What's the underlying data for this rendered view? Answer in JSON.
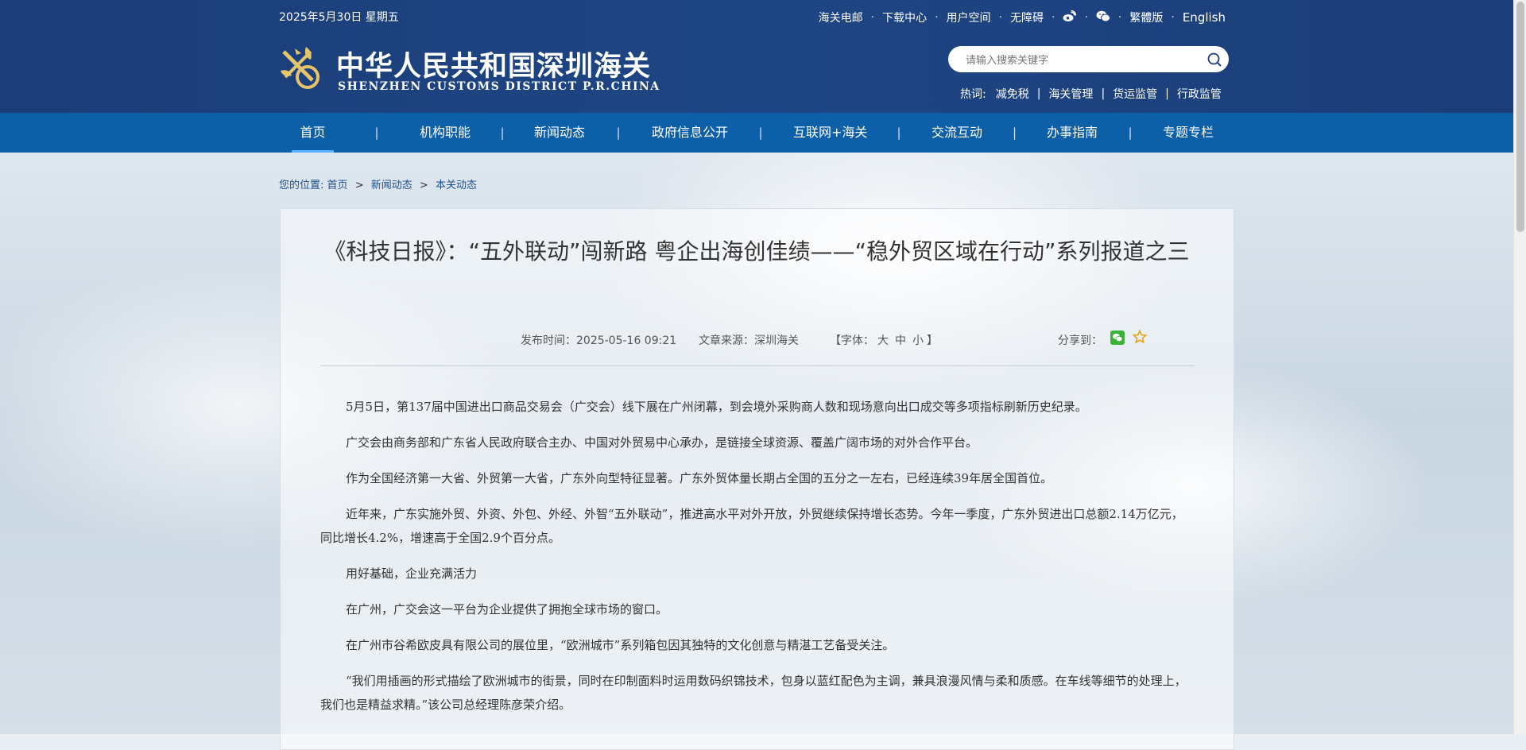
{
  "header": {
    "date": "2025年5月30日 星期五",
    "toplinks": [
      "海关电邮",
      "下载中心",
      "用户空间",
      "无障碍"
    ],
    "traditional": "繁體版",
    "english": "English",
    "logo_cn": "中华人民共和国深圳海关",
    "logo_en": "SHENZHEN CUSTOMS DISTRICT P.R.CHINA",
    "search_placeholder": "请输入搜索关键字",
    "hot_label": "热词:",
    "hot_words": [
      "减免税",
      "海关管理",
      "货运监管",
      "行政监管"
    ]
  },
  "nav": {
    "items": [
      "首页",
      "机构职能",
      "新闻动态",
      "政府信息公开",
      "互联网+海关",
      "交流互动",
      "办事指南",
      "专题专栏"
    ],
    "sep": "|"
  },
  "breadcrumb": {
    "label": "您的位置:",
    "items": [
      "首页",
      "新闻动态",
      "本关动态"
    ],
    "gt": ">"
  },
  "article": {
    "title": "《科技日报》：“五外联动”闯新路 粤企出海创佳绩——“稳外贸区域在行动”系列报道之三",
    "publish": "发布时间：2025-05-16 09:21",
    "source": "文章来源：深圳海关",
    "font_open": "【字体：",
    "font_sizes": [
      "大",
      "中",
      "小"
    ],
    "font_close": "】",
    "share": "分享到：",
    "paragraphs": [
      "5月5日，第137届中国进出口商品交易会（广交会）线下展在广州闭幕，到会境外采购商人数和现场意向出口成交等多项指标刷新历史纪录。",
      "广交会由商务部和广东省人民政府联合主办、中国对外贸易中心承办，是链接全球资源、覆盖广阔市场的对外合作平台。",
      "作为全国经济第一大省、外贸第一大省，广东外向型特征显著。广东外贸体量长期占全国的五分之一左右，已经连续39年居全国首位。",
      "近年来，广东实施外贸、外资、外包、外经、外智“五外联动”，推进高水平对外开放，外贸继续保持增长态势。今年一季度，广东外贸进出口总额2.14万亿元，同比增长4.2%，增速高于全国2.9个百分点。",
      "用好基础，企业充满活力",
      "在广州，广交会这一平台为企业提供了拥抱全球市场的窗口。",
      "在广州市谷希欧皮具有限公司的展位里，“欧洲城市”系列箱包因其独特的文化创意与精湛工艺备受关注。",
      "“我们用插画的形式描绘了欧洲城市的街景，同时在印制面料时运用数码织锦技术，包身以蓝红配色为主调，兼具浪漫风情与柔和质感。在车线等细节的处理上，我们也是精益求精。”该公司总经理陈彦荣介绍。"
    ]
  },
  "colors": {
    "header_bg": "#1e4684",
    "nav_bg": "#0d5fa8",
    "active_underline": "#5ab1ff"
  }
}
